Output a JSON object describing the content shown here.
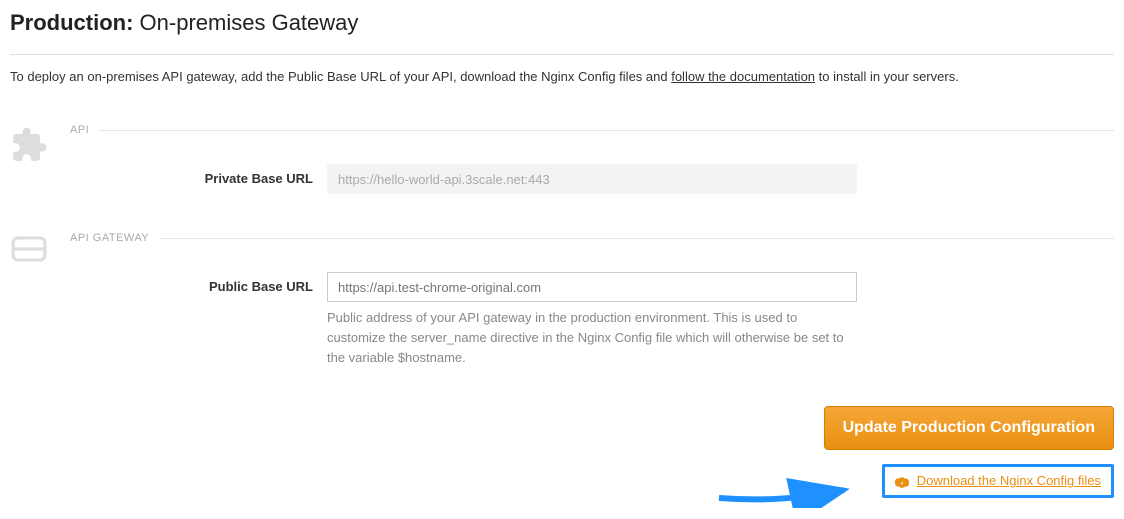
{
  "title_prefix": "Production:",
  "title_suffix": " On-premises Gateway",
  "intro": {
    "pre": "To deploy an on-premises API gateway, add the Public Base URL of your API, download the Nginx Config files and ",
    "link": "follow the documentation",
    "post": " to install in your servers."
  },
  "sections": {
    "api": {
      "label": "API",
      "fields": {
        "private_base_url": {
          "label": "Private Base URL",
          "value": "https://hello-world-api.3scale.net:443"
        }
      }
    },
    "gateway": {
      "label": "API GATEWAY",
      "fields": {
        "public_base_url": {
          "label": "Public Base URL",
          "placeholder": "https://api.test-chrome-original.com",
          "help": "Public address of your API gateway in the production environment. This is used to customize the server_name directive in the Nginx Config file which will otherwise be set to the variable $hostname."
        }
      }
    }
  },
  "actions": {
    "update_button": "Update Production Configuration",
    "download_link": "Download the Nginx Config files"
  }
}
